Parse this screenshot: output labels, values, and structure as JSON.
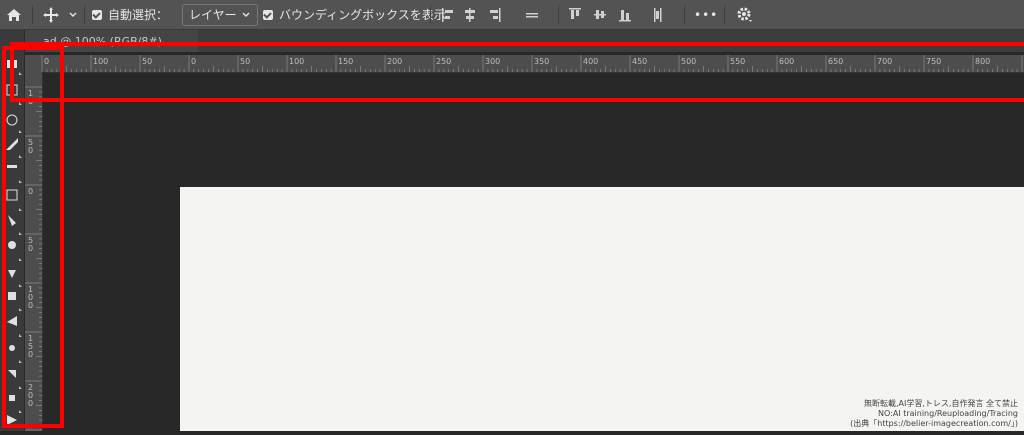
{
  "options_bar": {
    "home_icon": "home-icon",
    "move_icon": "move-tool-icon",
    "auto_select_label": "自動選択：",
    "layer_dropdown_value": "レイヤー",
    "bbox_label": "バウンディングボックスを表示",
    "more_label": "•••"
  },
  "document_tab": {
    "title": "…ad @ 100% (RGB/8#)"
  },
  "ruler_h_labels": [
    "0",
    "100",
    "50",
    "0",
    "50",
    "100",
    "150",
    "200",
    "250",
    "300",
    "350",
    "400",
    "450",
    "500",
    "550",
    "600",
    "650",
    "700",
    "750",
    "800",
    "8"
  ],
  "ruler_v_labels": [
    "1\n0",
    "5\n0",
    "0",
    "5\n0",
    "1\n0\n0",
    "1\n5\n0",
    "2\n0\n0"
  ],
  "watermark": {
    "line1": "無断転載,AI学習,トレス,自作発言 全て禁止",
    "line2": "NO:AI training/Reuploading/Tracing",
    "line3": "(出典「https://belier-imagecreation.com/」)"
  },
  "colors": {
    "annotation": "#ff0000",
    "canvas": "#f4f4f2"
  }
}
